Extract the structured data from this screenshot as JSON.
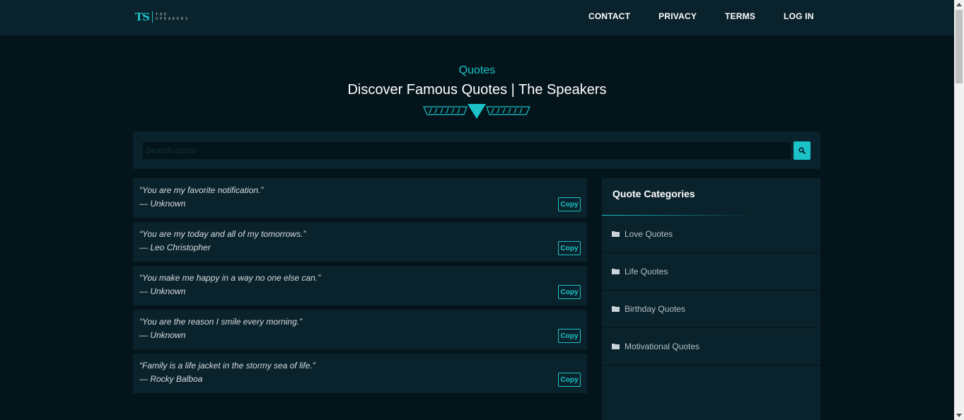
{
  "header": {
    "logo_mark": "TS",
    "logo_words": [
      "THE",
      "SPEAKERS"
    ],
    "nav": [
      "CONTACT",
      "PRIVACY",
      "TERMS",
      "LOG IN"
    ]
  },
  "hero": {
    "kicker": "Quotes",
    "title": "Discover Famous Quotes | The Speakers"
  },
  "search": {
    "placeholder": "Search quote"
  },
  "quotes": [
    {
      "text": "“You are my favorite notification.”",
      "author": "— Unknown",
      "copy_label": "Copy"
    },
    {
      "text": "“You are my today and all of my tomorrows.”",
      "author": "— Leo Christopher",
      "copy_label": "Copy"
    },
    {
      "text": "“You make me happy in a way no one else can.”",
      "author": "— Unknown",
      "copy_label": "Copy"
    },
    {
      "text": "“You are the reason I smile every morning.”",
      "author": "— Unknown",
      "copy_label": "Copy"
    },
    {
      "text": "“Family is a life jacket in the stormy sea of life.”",
      "author": "— Rocky Balboa",
      "copy_label": "Copy"
    }
  ],
  "sidebar": {
    "title": "Quote Categories",
    "categories": [
      "Love Quotes",
      "Life Quotes",
      "Birthday Quotes",
      "Motivational Quotes"
    ]
  },
  "colors": {
    "accent": "#1bc3c9",
    "background": "#04141b",
    "panel": "#0a222b"
  },
  "icons": {
    "search": "search-icon",
    "category": "folder-icon"
  }
}
